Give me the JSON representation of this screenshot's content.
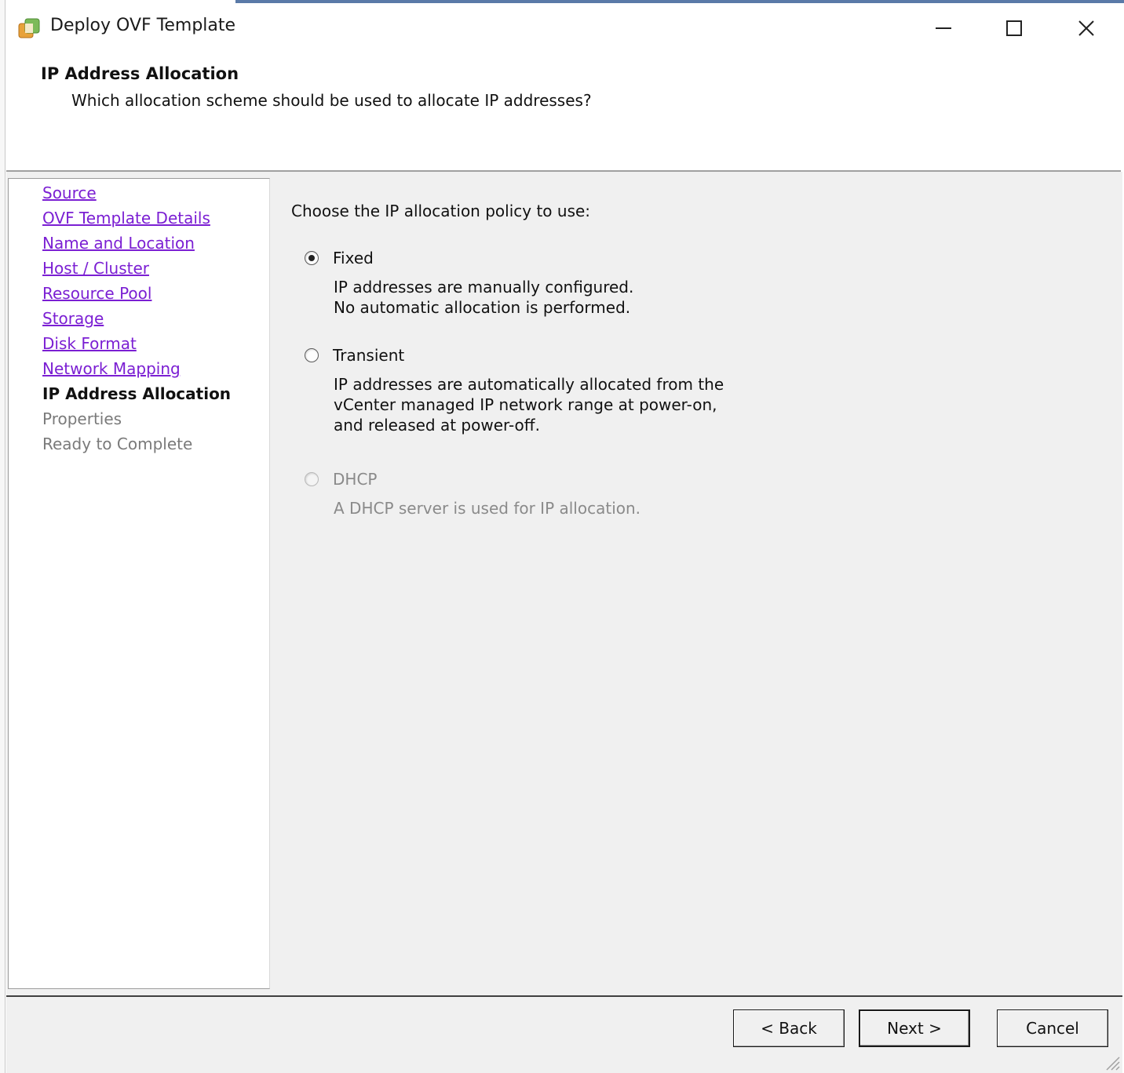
{
  "window": {
    "title": "Deploy OVF Template"
  },
  "header": {
    "title": "IP Address Allocation",
    "subtitle": "Which allocation scheme should be used to allocate IP addresses?"
  },
  "nav": {
    "items": [
      {
        "label": "Source",
        "state": "link"
      },
      {
        "label": "OVF Template Details",
        "state": "link"
      },
      {
        "label": "Name and Location",
        "state": "link"
      },
      {
        "label": "Host / Cluster",
        "state": "link"
      },
      {
        "label": "Resource Pool",
        "state": "link"
      },
      {
        "label": "Storage",
        "state": "link"
      },
      {
        "label": "Disk Format",
        "state": "link"
      },
      {
        "label": "Network Mapping",
        "state": "link"
      },
      {
        "label": "IP Address Allocation",
        "state": "current"
      },
      {
        "label": "Properties",
        "state": "disabled"
      },
      {
        "label": "Ready to Complete",
        "state": "disabled"
      }
    ]
  },
  "content": {
    "prompt": "Choose the IP allocation policy to use:",
    "options": {
      "fixed": {
        "label": "Fixed",
        "checked": true,
        "desc_line1": "IP addresses are manually configured.",
        "desc_line2": "No automatic allocation is performed."
      },
      "transient": {
        "label": "Transient",
        "checked": false,
        "desc_line1": "IP addresses are automatically allocated from the",
        "desc_line2": "vCenter managed IP network range at power-on,",
        "desc_line3": "and released at power-off."
      },
      "dhcp": {
        "label": "DHCP",
        "checked": false,
        "disabled": true,
        "desc_line1": "A DHCP server is used for IP allocation."
      }
    }
  },
  "footer": {
    "back_label": "< Back",
    "next_label": "Next >",
    "cancel_label": "Cancel"
  },
  "colors": {
    "link": "#7b1fd3",
    "panel_bg": "#f0f0f0",
    "icon_orange": "#e8a23a",
    "icon_green": "#6aa84f"
  }
}
